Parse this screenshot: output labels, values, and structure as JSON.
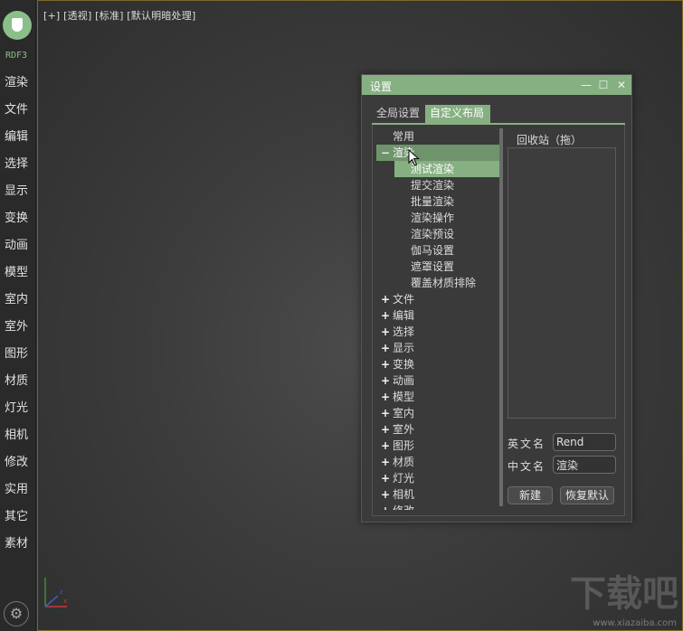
{
  "sidebar": {
    "brand": "RDF3",
    "items": [
      "渲染",
      "文件",
      "编辑",
      "选择",
      "显示",
      "变换",
      "动画",
      "模型",
      "室内",
      "室外",
      "图形",
      "材质",
      "灯光",
      "相机",
      "修改",
      "实用",
      "其它",
      "素材"
    ],
    "logo_icon": "shield-icon",
    "bottom_icon": "gear-icon"
  },
  "viewport": {
    "label": "[+] [透视] [标准] [默认明暗处理]",
    "border_color": "#7a6a2a"
  },
  "watermark": {
    "text": "下载吧",
    "url": "www.xiazaiba.com"
  },
  "dialog": {
    "title": "设置",
    "accent_color": "#86b082",
    "tabs": [
      {
        "label": "全局设置",
        "active": false
      },
      {
        "label": "自定义布局",
        "active": true
      }
    ],
    "tree": {
      "top": "常用",
      "expanded_group": "渲染",
      "expanded_toggle": "−",
      "children": [
        "测试渲染",
        "提交渲染",
        "批量渲染",
        "渲染操作",
        "渲染预设",
        "伽马设置",
        "遮罩设置",
        "覆盖材质排除"
      ],
      "selected_child": "测试渲染",
      "collapsed_toggle": "+",
      "collapsed_groups": [
        "文件",
        "编辑",
        "选择",
        "显示",
        "变换",
        "动画",
        "模型",
        "室内",
        "室外",
        "图形",
        "材质",
        "灯光",
        "相机",
        "修改"
      ]
    },
    "recycle_bin_label": "回收站（拖）",
    "fields": {
      "en_name_label": "英文名",
      "en_name_value": "Rend",
      "cn_name_label": "中文名",
      "cn_name_value": "渲染"
    },
    "buttons": {
      "new": "新建",
      "reset": "恢复默认"
    }
  }
}
